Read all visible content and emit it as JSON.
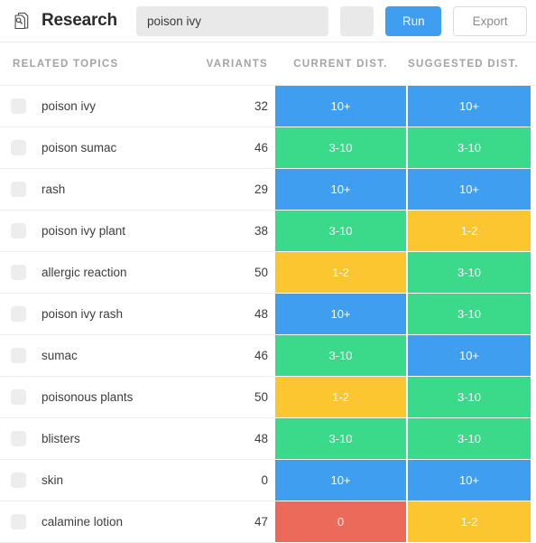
{
  "toolbar": {
    "icon": "document-search-icon",
    "title": "Research",
    "search_value": "poison ivy",
    "search_placeholder": "",
    "blank_button_label": "",
    "run_label": "Run",
    "export_label": "Export"
  },
  "table": {
    "columns": [
      {
        "key": "topic",
        "label": "RELATED TOPICS"
      },
      {
        "key": "variants",
        "label": "VARIANTS"
      },
      {
        "key": "current",
        "label": "CURRENT DIST."
      },
      {
        "key": "suggested",
        "label": "SUGGESTED DIST."
      }
    ],
    "colors": {
      "blue": "#409ef0",
      "green": "#3bd98a",
      "yellow": "#fbc62f",
      "red": "#ec6a5a"
    },
    "rows": [
      {
        "topic": "poison ivy",
        "variants": "32",
        "current": "10+",
        "current_color": "blue",
        "suggested": "10+",
        "suggested_color": "blue"
      },
      {
        "topic": "poison sumac",
        "variants": "46",
        "current": "3-10",
        "current_color": "green",
        "suggested": "3-10",
        "suggested_color": "green"
      },
      {
        "topic": "rash",
        "variants": "29",
        "current": "10+",
        "current_color": "blue",
        "suggested": "10+",
        "suggested_color": "blue"
      },
      {
        "topic": "poison ivy plant",
        "variants": "38",
        "current": "3-10",
        "current_color": "green",
        "suggested": "1-2",
        "suggested_color": "yellow"
      },
      {
        "topic": "allergic reaction",
        "variants": "50",
        "current": "1-2",
        "current_color": "yellow",
        "suggested": "3-10",
        "suggested_color": "green"
      },
      {
        "topic": "poison ivy rash",
        "variants": "48",
        "current": "10+",
        "current_color": "blue",
        "suggested": "3-10",
        "suggested_color": "green"
      },
      {
        "topic": "sumac",
        "variants": "46",
        "current": "3-10",
        "current_color": "green",
        "suggested": "10+",
        "suggested_color": "blue"
      },
      {
        "topic": "poisonous plants",
        "variants": "50",
        "current": "1-2",
        "current_color": "yellow",
        "suggested": "3-10",
        "suggested_color": "green"
      },
      {
        "topic": "blisters",
        "variants": "48",
        "current": "3-10",
        "current_color": "green",
        "suggested": "3-10",
        "suggested_color": "green"
      },
      {
        "topic": "skin",
        "variants": "0",
        "current": "10+",
        "current_color": "blue",
        "suggested": "10+",
        "suggested_color": "blue"
      },
      {
        "topic": "calamine lotion",
        "variants": "47",
        "current": "0",
        "current_color": "red",
        "suggested": "1-2",
        "suggested_color": "yellow"
      }
    ]
  }
}
